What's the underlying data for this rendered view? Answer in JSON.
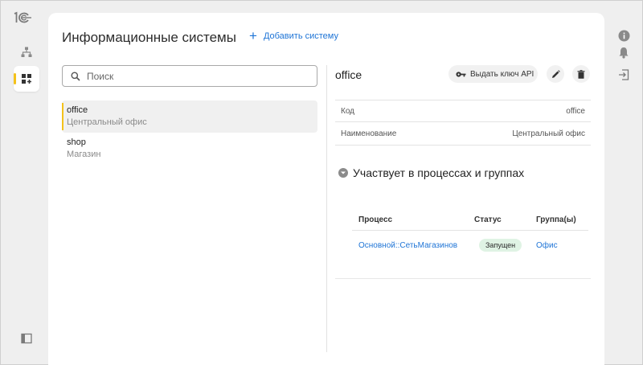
{
  "app": {
    "logo_text": "1С"
  },
  "colors": {
    "accent": "#1e74d6",
    "selection_marker": "#f4c21a",
    "status_running_bg": "#dff3e4"
  },
  "left_rail": {
    "items": [
      {
        "icon": "hierarchy-icon",
        "active": false
      },
      {
        "icon": "dashboard-add-icon",
        "active": true
      }
    ],
    "bottom_icon": "sidebar-toggle-icon"
  },
  "right_rail": {
    "icons": [
      "info-icon",
      "bell-icon",
      "logout-icon"
    ]
  },
  "header": {
    "title": "Информационные системы",
    "add_label": "Добавить систему"
  },
  "search": {
    "placeholder": "Поиск",
    "value": ""
  },
  "systems": [
    {
      "name": "office",
      "description": "Центральный офис",
      "selected": true
    },
    {
      "name": "shop",
      "description": "Магазин",
      "selected": false
    }
  ],
  "details": {
    "title": "office",
    "api_key_label": "Выдать ключ API",
    "fields": [
      {
        "label": "Код",
        "value": "office"
      },
      {
        "label": "Наименование",
        "value": "Центральный офис"
      }
    ],
    "section_title": "Участвует в процессах и группах",
    "table": {
      "headers": {
        "process": "Процесс",
        "status": "Статус",
        "groups": "Группа(ы)"
      },
      "rows": [
        {
          "process": "Основной::СетьМагазинов",
          "status": "Запущен",
          "groups": "Офис"
        }
      ]
    }
  }
}
